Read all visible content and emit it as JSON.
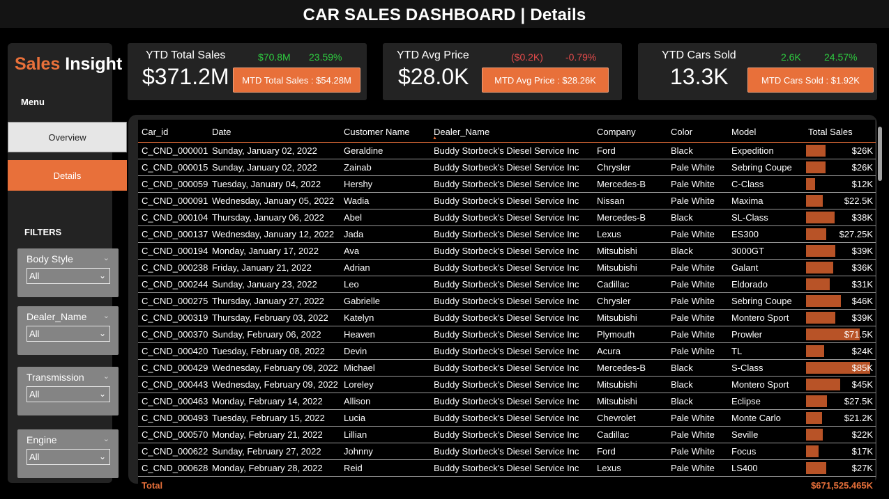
{
  "header": {
    "title": "CAR SALES DASHBOARD | Details"
  },
  "sidebar": {
    "brand_part1": "Sales",
    "brand_part2": " Insight",
    "menu_label": "Menu",
    "nav": {
      "overview": "Overview",
      "details": "Details"
    },
    "filters_label": "FILTERS",
    "slicers": [
      {
        "title": "Body Style",
        "value": "All"
      },
      {
        "title": "Dealer_Name",
        "value": "All"
      },
      {
        "title": "Transmission",
        "value": "All"
      },
      {
        "title": "Engine",
        "value": "All"
      }
    ]
  },
  "kpis": [
    {
      "title": "YTD Total Sales",
      "value": "$371.2M",
      "delta_abs": "$70.8M",
      "delta_pct": "23.59%",
      "delta_color": "#2ecc40",
      "mtd": "MTD Total Sales : $54.28M"
    },
    {
      "title": "YTD Avg Price",
      "value": "$28.0K",
      "delta_abs": "($0.2K)",
      "delta_pct": "-0.79%",
      "delta_color": "#e34b4b",
      "mtd": "MTD Avg Price : $28.26K"
    },
    {
      "title": "YTD Cars Sold",
      "value": "13.3K",
      "delta_abs": "2.6K",
      "delta_pct": "24.57%",
      "delta_color": "#2ecc40",
      "mtd": "MTD Cars Sold : $1.92K"
    }
  ],
  "table": {
    "columns": [
      "Car_id",
      "Date",
      "Customer Name",
      "Dealer_Name",
      "Company",
      "Color",
      "Model",
      "Total Sales"
    ],
    "sorted_column": "Dealer_Name",
    "bar_color": "#b85327",
    "rows": [
      {
        "car_id": "C_CND_000001",
        "date": "Sunday, January 02, 2022",
        "customer": "Geraldine",
        "dealer": "Buddy Storbeck's Diesel Service Inc",
        "company": "Ford",
        "color": "Black",
        "model": "Expedition",
        "sales_label": "$26K",
        "sales_value": 26000
      },
      {
        "car_id": "C_CND_000015",
        "date": "Sunday, January 02, 2022",
        "customer": "Zainab",
        "dealer": "Buddy Storbeck's Diesel Service Inc",
        "company": "Chrysler",
        "color": "Pale White",
        "model": "Sebring Coupe",
        "sales_label": "$26K",
        "sales_value": 26000
      },
      {
        "car_id": "C_CND_000059",
        "date": "Tuesday, January 04, 2022",
        "customer": "Hershy",
        "dealer": "Buddy Storbeck's Diesel Service Inc",
        "company": "Mercedes-B",
        "color": "Pale White",
        "model": "C-Class",
        "sales_label": "$12K",
        "sales_value": 12000
      },
      {
        "car_id": "C_CND_000091",
        "date": "Wednesday, January 05, 2022",
        "customer": "Wadia",
        "dealer": "Buddy Storbeck's Diesel Service Inc",
        "company": "Nissan",
        "color": "Pale White",
        "model": "Maxima",
        "sales_label": "$22.5K",
        "sales_value": 22500
      },
      {
        "car_id": "C_CND_000104",
        "date": "Thursday, January 06, 2022",
        "customer": "Abel",
        "dealer": "Buddy Storbeck's Diesel Service Inc",
        "company": "Mercedes-B",
        "color": "Black",
        "model": "SL-Class",
        "sales_label": "$38K",
        "sales_value": 38000
      },
      {
        "car_id": "C_CND_000137",
        "date": "Wednesday, January 12, 2022",
        "customer": "Jada",
        "dealer": "Buddy Storbeck's Diesel Service Inc",
        "company": "Lexus",
        "color": "Pale White",
        "model": "ES300",
        "sales_label": "$27.25K",
        "sales_value": 27250
      },
      {
        "car_id": "C_CND_000194",
        "date": "Monday, January 17, 2022",
        "customer": "Ava",
        "dealer": "Buddy Storbeck's Diesel Service Inc",
        "company": "Mitsubishi",
        "color": "Black",
        "model": "3000GT",
        "sales_label": "$39K",
        "sales_value": 39000
      },
      {
        "car_id": "C_CND_000238",
        "date": "Friday, January 21, 2022",
        "customer": "Adrian",
        "dealer": "Buddy Storbeck's Diesel Service Inc",
        "company": "Mitsubishi",
        "color": "Pale White",
        "model": "Galant",
        "sales_label": "$36K",
        "sales_value": 36000
      },
      {
        "car_id": "C_CND_000244",
        "date": "Sunday, January 23, 2022",
        "customer": "Leo",
        "dealer": "Buddy Storbeck's Diesel Service Inc",
        "company": "Cadillac",
        "color": "Pale White",
        "model": "Eldorado",
        "sales_label": "$31K",
        "sales_value": 31000
      },
      {
        "car_id": "C_CND_000275",
        "date": "Thursday, January 27, 2022",
        "customer": "Gabrielle",
        "dealer": "Buddy Storbeck's Diesel Service Inc",
        "company": "Chrysler",
        "color": "Pale White",
        "model": "Sebring Coupe",
        "sales_label": "$46K",
        "sales_value": 46000
      },
      {
        "car_id": "C_CND_000319",
        "date": "Thursday, February 03, 2022",
        "customer": "Katelyn",
        "dealer": "Buddy Storbeck's Diesel Service Inc",
        "company": "Mitsubishi",
        "color": "Pale White",
        "model": "Montero Sport",
        "sales_label": "$39K",
        "sales_value": 39000
      },
      {
        "car_id": "C_CND_000370",
        "date": "Sunday, February 06, 2022",
        "customer": "Heaven",
        "dealer": "Buddy Storbeck's Diesel Service Inc",
        "company": "Plymouth",
        "color": "Pale White",
        "model": "Prowler",
        "sales_label": "$71.5K",
        "sales_value": 71500
      },
      {
        "car_id": "C_CND_000420",
        "date": "Tuesday, February 08, 2022",
        "customer": "Devin",
        "dealer": "Buddy Storbeck's Diesel Service Inc",
        "company": "Acura",
        "color": "Pale White",
        "model": "TL",
        "sales_label": "$24K",
        "sales_value": 24000
      },
      {
        "car_id": "C_CND_000429",
        "date": "Wednesday, February 09, 2022",
        "customer": "Michael",
        "dealer": "Buddy Storbeck's Diesel Service Inc",
        "company": "Mercedes-B",
        "color": "Black",
        "model": "S-Class",
        "sales_label": "$85K",
        "sales_value": 85000
      },
      {
        "car_id": "C_CND_000443",
        "date": "Wednesday, February 09, 2022",
        "customer": "Loreley",
        "dealer": "Buddy Storbeck's Diesel Service Inc",
        "company": "Mitsubishi",
        "color": "Black",
        "model": "Montero Sport",
        "sales_label": "$45K",
        "sales_value": 45000
      },
      {
        "car_id": "C_CND_000463",
        "date": "Monday, February 14, 2022",
        "customer": "Allison",
        "dealer": "Buddy Storbeck's Diesel Service Inc",
        "company": "Mitsubishi",
        "color": "Black",
        "model": "Eclipse",
        "sales_label": "$27.5K",
        "sales_value": 27500
      },
      {
        "car_id": "C_CND_000493",
        "date": "Tuesday, February 15, 2022",
        "customer": "Lucia",
        "dealer": "Buddy Storbeck's Diesel Service Inc",
        "company": "Chevrolet",
        "color": "Pale White",
        "model": "Monte Carlo",
        "sales_label": "$21.2K",
        "sales_value": 21200
      },
      {
        "car_id": "C_CND_000570",
        "date": "Monday, February 21, 2022",
        "customer": "Lillian",
        "dealer": "Buddy Storbeck's Diesel Service Inc",
        "company": "Cadillac",
        "color": "Pale White",
        "model": "Seville",
        "sales_label": "$22K",
        "sales_value": 22000
      },
      {
        "car_id": "C_CND_000622",
        "date": "Sunday, February 27, 2022",
        "customer": "Johnny",
        "dealer": "Buddy Storbeck's Diesel Service Inc",
        "company": "Ford",
        "color": "Pale White",
        "model": "Focus",
        "sales_label": "$17K",
        "sales_value": 17000
      },
      {
        "car_id": "C_CND_000628",
        "date": "Monday, February 28, 2022",
        "customer": "Reid",
        "dealer": "Buddy Storbeck's Diesel Service Inc",
        "company": "Lexus",
        "color": "Pale White",
        "model": "LS400",
        "sales_label": "$27K",
        "sales_value": 27000
      }
    ],
    "total_label": "Total",
    "total_value": "$671,525.465K"
  }
}
